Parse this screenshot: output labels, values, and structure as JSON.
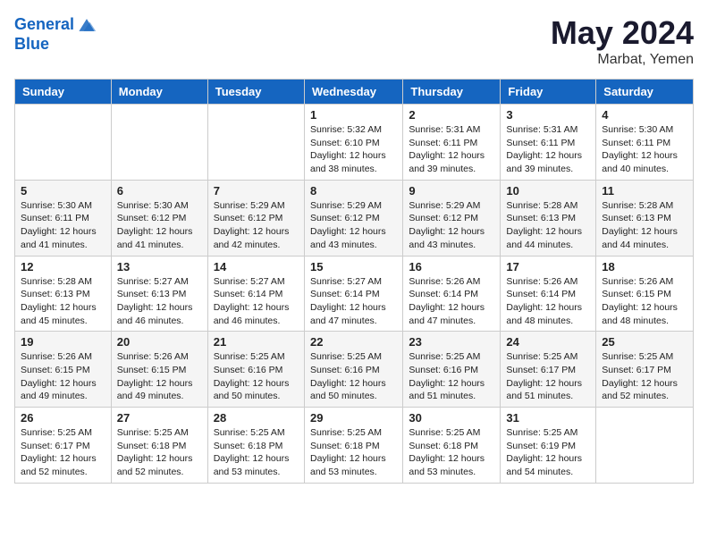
{
  "header": {
    "logo_line1": "General",
    "logo_line2": "Blue",
    "month": "May 2024",
    "location": "Marbat, Yemen"
  },
  "weekdays": [
    "Sunday",
    "Monday",
    "Tuesday",
    "Wednesday",
    "Thursday",
    "Friday",
    "Saturday"
  ],
  "weeks": [
    [
      {
        "day": "",
        "info": ""
      },
      {
        "day": "",
        "info": ""
      },
      {
        "day": "",
        "info": ""
      },
      {
        "day": "1",
        "info": "Sunrise: 5:32 AM\nSunset: 6:10 PM\nDaylight: 12 hours and 38 minutes."
      },
      {
        "day": "2",
        "info": "Sunrise: 5:31 AM\nSunset: 6:11 PM\nDaylight: 12 hours and 39 minutes."
      },
      {
        "day": "3",
        "info": "Sunrise: 5:31 AM\nSunset: 6:11 PM\nDaylight: 12 hours and 39 minutes."
      },
      {
        "day": "4",
        "info": "Sunrise: 5:30 AM\nSunset: 6:11 PM\nDaylight: 12 hours and 40 minutes."
      }
    ],
    [
      {
        "day": "5",
        "info": "Sunrise: 5:30 AM\nSunset: 6:11 PM\nDaylight: 12 hours and 41 minutes."
      },
      {
        "day": "6",
        "info": "Sunrise: 5:30 AM\nSunset: 6:12 PM\nDaylight: 12 hours and 41 minutes."
      },
      {
        "day": "7",
        "info": "Sunrise: 5:29 AM\nSunset: 6:12 PM\nDaylight: 12 hours and 42 minutes."
      },
      {
        "day": "8",
        "info": "Sunrise: 5:29 AM\nSunset: 6:12 PM\nDaylight: 12 hours and 43 minutes."
      },
      {
        "day": "9",
        "info": "Sunrise: 5:29 AM\nSunset: 6:12 PM\nDaylight: 12 hours and 43 minutes."
      },
      {
        "day": "10",
        "info": "Sunrise: 5:28 AM\nSunset: 6:13 PM\nDaylight: 12 hours and 44 minutes."
      },
      {
        "day": "11",
        "info": "Sunrise: 5:28 AM\nSunset: 6:13 PM\nDaylight: 12 hours and 44 minutes."
      }
    ],
    [
      {
        "day": "12",
        "info": "Sunrise: 5:28 AM\nSunset: 6:13 PM\nDaylight: 12 hours and 45 minutes."
      },
      {
        "day": "13",
        "info": "Sunrise: 5:27 AM\nSunset: 6:13 PM\nDaylight: 12 hours and 46 minutes."
      },
      {
        "day": "14",
        "info": "Sunrise: 5:27 AM\nSunset: 6:14 PM\nDaylight: 12 hours and 46 minutes."
      },
      {
        "day": "15",
        "info": "Sunrise: 5:27 AM\nSunset: 6:14 PM\nDaylight: 12 hours and 47 minutes."
      },
      {
        "day": "16",
        "info": "Sunrise: 5:26 AM\nSunset: 6:14 PM\nDaylight: 12 hours and 47 minutes."
      },
      {
        "day": "17",
        "info": "Sunrise: 5:26 AM\nSunset: 6:14 PM\nDaylight: 12 hours and 48 minutes."
      },
      {
        "day": "18",
        "info": "Sunrise: 5:26 AM\nSunset: 6:15 PM\nDaylight: 12 hours and 48 minutes."
      }
    ],
    [
      {
        "day": "19",
        "info": "Sunrise: 5:26 AM\nSunset: 6:15 PM\nDaylight: 12 hours and 49 minutes."
      },
      {
        "day": "20",
        "info": "Sunrise: 5:26 AM\nSunset: 6:15 PM\nDaylight: 12 hours and 49 minutes."
      },
      {
        "day": "21",
        "info": "Sunrise: 5:25 AM\nSunset: 6:16 PM\nDaylight: 12 hours and 50 minutes."
      },
      {
        "day": "22",
        "info": "Sunrise: 5:25 AM\nSunset: 6:16 PM\nDaylight: 12 hours and 50 minutes."
      },
      {
        "day": "23",
        "info": "Sunrise: 5:25 AM\nSunset: 6:16 PM\nDaylight: 12 hours and 51 minutes."
      },
      {
        "day": "24",
        "info": "Sunrise: 5:25 AM\nSunset: 6:17 PM\nDaylight: 12 hours and 51 minutes."
      },
      {
        "day": "25",
        "info": "Sunrise: 5:25 AM\nSunset: 6:17 PM\nDaylight: 12 hours and 52 minutes."
      }
    ],
    [
      {
        "day": "26",
        "info": "Sunrise: 5:25 AM\nSunset: 6:17 PM\nDaylight: 12 hours and 52 minutes."
      },
      {
        "day": "27",
        "info": "Sunrise: 5:25 AM\nSunset: 6:18 PM\nDaylight: 12 hours and 52 minutes."
      },
      {
        "day": "28",
        "info": "Sunrise: 5:25 AM\nSunset: 6:18 PM\nDaylight: 12 hours and 53 minutes."
      },
      {
        "day": "29",
        "info": "Sunrise: 5:25 AM\nSunset: 6:18 PM\nDaylight: 12 hours and 53 minutes."
      },
      {
        "day": "30",
        "info": "Sunrise: 5:25 AM\nSunset: 6:18 PM\nDaylight: 12 hours and 53 minutes."
      },
      {
        "day": "31",
        "info": "Sunrise: 5:25 AM\nSunset: 6:19 PM\nDaylight: 12 hours and 54 minutes."
      },
      {
        "day": "",
        "info": ""
      }
    ]
  ]
}
